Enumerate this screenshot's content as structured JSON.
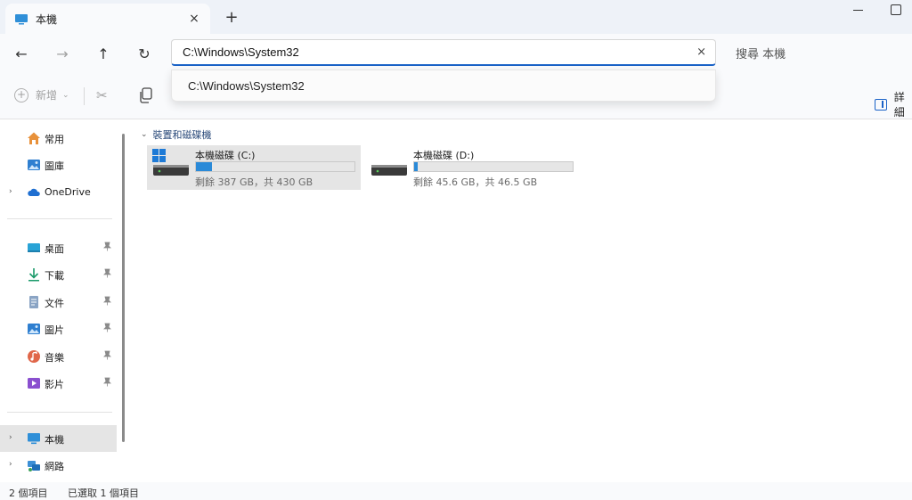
{
  "tab": {
    "title": "本機",
    "close": "×"
  },
  "new_tab": "+",
  "nav": {
    "back": "←",
    "forward": "→",
    "up": "↑",
    "refresh": "↻",
    "address_value": "C:\\Windows\\System32",
    "address_clear": "×",
    "search_placeholder": "搜尋 本機"
  },
  "suggestion": {
    "item": "C:\\Windows\\System32"
  },
  "commands": {
    "new_label": "新增",
    "new_chevron": "⌄",
    "cut": "✂",
    "details_label": "詳細"
  },
  "sidebar": {
    "items": [
      {
        "label": "常用",
        "icon": "home-icon"
      },
      {
        "label": "圖庫",
        "icon": "gallery-icon"
      },
      {
        "label": "OneDrive",
        "icon": "cloud-icon",
        "expander": "›"
      },
      {
        "label": "桌面",
        "icon": "desktop-icon",
        "pin": "📌"
      },
      {
        "label": "下載",
        "icon": "download-icon",
        "pin": "📌"
      },
      {
        "label": "文件",
        "icon": "document-icon",
        "pin": "📌"
      },
      {
        "label": "圖片",
        "icon": "pictures-icon",
        "pin": "📌"
      },
      {
        "label": "音樂",
        "icon": "music-icon",
        "pin": "📌"
      },
      {
        "label": "影片",
        "icon": "videos-icon",
        "pin": "📌"
      },
      {
        "label": "本機",
        "icon": "pc-icon",
        "expander": "›",
        "selected": true
      },
      {
        "label": "網路",
        "icon": "network-icon",
        "expander": "›"
      }
    ]
  },
  "main": {
    "group_title": "裝置和磁碟機",
    "group_chevron": "⌄",
    "drives": [
      {
        "name": "本機磁碟 (C:)",
        "free": "剩餘 387 GB，共 430 GB",
        "used_fraction": 0.1,
        "selected": true
      },
      {
        "name": "本機磁碟 (D:)",
        "free": "剩餘 45.6 GB，共 46.5 GB",
        "used_fraction": 0.02,
        "selected": false
      }
    ]
  },
  "status": {
    "count": "2 個項目",
    "selected": "已選取 1 個項目"
  },
  "colors": {
    "accent": "#1a62c7",
    "drive_fill": "#2a8ad8",
    "selection": "#e5e5e5"
  }
}
